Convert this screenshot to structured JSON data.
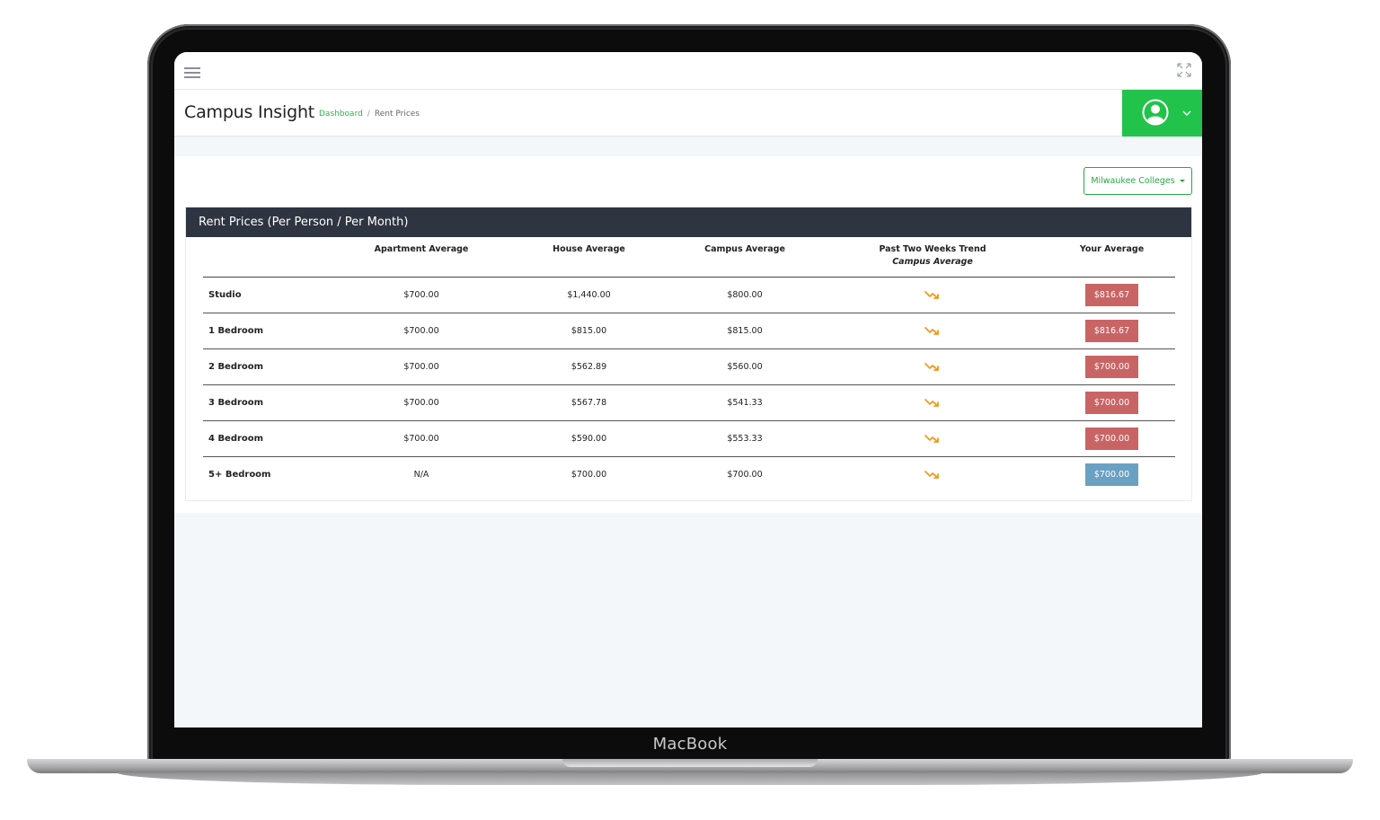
{
  "device": {
    "brand": "MacBook"
  },
  "app": {
    "title": "Campus Insight"
  },
  "breadcrumb": {
    "link": "Dashboard",
    "separator": "/",
    "current": "Rent Prices"
  },
  "colors": {
    "accent": "#22c34b",
    "above": "#c96465",
    "below": "#6aa1c2",
    "trend": "#f39a1e",
    "card_header": "#2e3440"
  },
  "filter": {
    "label": "Milwaukee Colleges"
  },
  "card": {
    "title": "Rent Prices (Per Person / Per Month)"
  },
  "table": {
    "headers": {
      "type": "",
      "apartment": "Apartment Average",
      "house": "House Average",
      "campus": "Campus Average",
      "trend": "Past Two Weeks Trend",
      "trend_sub": "Campus Average",
      "yours": "Your Average"
    },
    "rows": [
      {
        "type": "Studio",
        "apartment": "$700.00",
        "house": "$1,440.00",
        "campus": "$800.00",
        "trend_icon": "trend-down-icon",
        "yours": "$816.67",
        "status": "above"
      },
      {
        "type": "1 Bedroom",
        "apartment": "$700.00",
        "house": "$815.00",
        "campus": "$815.00",
        "trend_icon": "trend-down-icon",
        "yours": "$816.67",
        "status": "above"
      },
      {
        "type": "2 Bedroom",
        "apartment": "$700.00",
        "house": "$562.89",
        "campus": "$560.00",
        "trend_icon": "trend-down-icon",
        "yours": "$700.00",
        "status": "above"
      },
      {
        "type": "3 Bedroom",
        "apartment": "$700.00",
        "house": "$567.78",
        "campus": "$541.33",
        "trend_icon": "trend-down-icon",
        "yours": "$700.00",
        "status": "above"
      },
      {
        "type": "4 Bedroom",
        "apartment": "$700.00",
        "house": "$590.00",
        "campus": "$553.33",
        "trend_icon": "trend-down-icon",
        "yours": "$700.00",
        "status": "above"
      },
      {
        "type": "5+ Bedroom",
        "apartment": "N/A",
        "house": "$700.00",
        "campus": "$700.00",
        "trend_icon": "trend-down-icon",
        "yours": "$700.00",
        "status": "below"
      }
    ]
  }
}
